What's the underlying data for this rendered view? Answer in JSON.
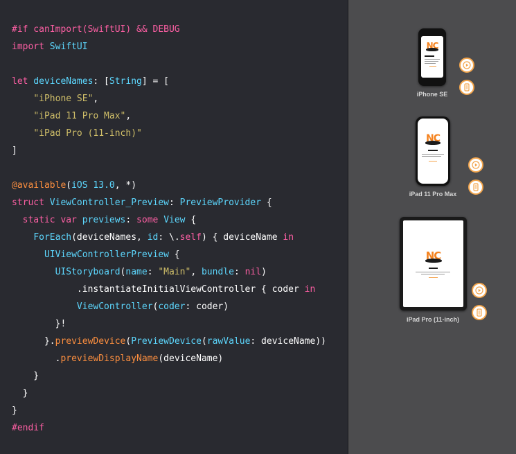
{
  "editor": {
    "lines": [
      [
        {
          "t": "#if canImport(SwiftUI) && DEBUG",
          "c": "keyword"
        }
      ],
      [
        {
          "t": "import",
          "c": "keyword"
        },
        {
          "t": " SwiftUI",
          "c": "decl"
        }
      ],
      [],
      [
        {
          "t": "let",
          "c": "keyword"
        },
        {
          "t": " deviceNames",
          "c": "decl"
        },
        {
          "t": ": [",
          "c": "plain"
        },
        {
          "t": "String",
          "c": "decl"
        },
        {
          "t": "] = [",
          "c": "plain"
        }
      ],
      [
        {
          "t": "    ",
          "c": "plain"
        },
        {
          "t": "\"iPhone SE\"",
          "c": "number"
        },
        {
          "t": ",",
          "c": "plain"
        }
      ],
      [
        {
          "t": "    ",
          "c": "plain"
        },
        {
          "t": "\"iPad 11 Pro Max\"",
          "c": "number"
        },
        {
          "t": ",",
          "c": "plain"
        }
      ],
      [
        {
          "t": "    ",
          "c": "plain"
        },
        {
          "t": "\"iPad Pro (11-inch)\"",
          "c": "number"
        }
      ],
      [
        {
          "t": "]",
          "c": "plain"
        }
      ],
      [],
      [
        {
          "t": "@available",
          "c": "orange"
        },
        {
          "t": "(",
          "c": "plain"
        },
        {
          "t": "iOS 13.0",
          "c": "decl"
        },
        {
          "t": ", *)",
          "c": "plain"
        }
      ],
      [
        {
          "t": "struct",
          "c": "keyword"
        },
        {
          "t": " ViewController_Preview",
          "c": "decl"
        },
        {
          "t": ": ",
          "c": "plain"
        },
        {
          "t": "PreviewProvider",
          "c": "decl"
        },
        {
          "t": " {",
          "c": "plain"
        }
      ],
      [
        {
          "t": "  ",
          "c": "plain"
        },
        {
          "t": "static",
          "c": "keyword"
        },
        {
          "t": " ",
          "c": "plain"
        },
        {
          "t": "var",
          "c": "keyword"
        },
        {
          "t": " previews",
          "c": "decl"
        },
        {
          "t": ": ",
          "c": "plain"
        },
        {
          "t": "some",
          "c": "keyword"
        },
        {
          "t": " ",
          "c": "plain"
        },
        {
          "t": "View",
          "c": "decl"
        },
        {
          "t": " {",
          "c": "plain"
        }
      ],
      [
        {
          "t": "    ",
          "c": "plain"
        },
        {
          "t": "ForEach",
          "c": "decl"
        },
        {
          "t": "(deviceNames, ",
          "c": "plain"
        },
        {
          "t": "id",
          "c": "decl"
        },
        {
          "t": ": \\.",
          "c": "plain"
        },
        {
          "t": "self",
          "c": "keyword"
        },
        {
          "t": ") { deviceName ",
          "c": "plain"
        },
        {
          "t": "in",
          "c": "keyword"
        }
      ],
      [
        {
          "t": "      ",
          "c": "plain"
        },
        {
          "t": "UIViewControllerPreview",
          "c": "decl"
        },
        {
          "t": " {",
          "c": "plain"
        }
      ],
      [
        {
          "t": "        ",
          "c": "plain"
        },
        {
          "t": "UIStoryboard",
          "c": "decl"
        },
        {
          "t": "(",
          "c": "plain"
        },
        {
          "t": "name",
          "c": "decl"
        },
        {
          "t": ": ",
          "c": "plain"
        },
        {
          "t": "\"Main\"",
          "c": "number"
        },
        {
          "t": ", ",
          "c": "plain"
        },
        {
          "t": "bundle",
          "c": "decl"
        },
        {
          "t": ": ",
          "c": "plain"
        },
        {
          "t": "nil",
          "c": "keyword"
        },
        {
          "t": ")",
          "c": "plain"
        }
      ],
      [
        {
          "t": "            .instantiateInitialViewController { coder ",
          "c": "plain"
        },
        {
          "t": "in",
          "c": "keyword"
        }
      ],
      [
        {
          "t": "            ",
          "c": "plain"
        },
        {
          "t": "ViewController",
          "c": "decl"
        },
        {
          "t": "(",
          "c": "plain"
        },
        {
          "t": "coder",
          "c": "decl"
        },
        {
          "t": ": coder)",
          "c": "plain"
        }
      ],
      [
        {
          "t": "        }!",
          "c": "plain"
        },
        {
          "t": "",
          "c": "plain"
        }
      ],
      [
        {
          "t": "      }.",
          "c": "plain"
        },
        {
          "t": "previewDevice",
          "c": "orange"
        },
        {
          "t": "(",
          "c": "plain"
        },
        {
          "t": "PreviewDevice",
          "c": "decl"
        },
        {
          "t": "(",
          "c": "plain"
        },
        {
          "t": "rawValue",
          "c": "decl"
        },
        {
          "t": ": deviceName))",
          "c": "plain"
        }
      ],
      [
        {
          "t": "        .",
          "c": "plain"
        },
        {
          "t": "previewDisplayName",
          "c": "orange"
        },
        {
          "t": "(deviceName)",
          "c": "plain"
        }
      ],
      [
        {
          "t": "    }",
          "c": "plain"
        }
      ],
      [
        {
          "t": "  }",
          "c": "plain"
        }
      ],
      [
        {
          "t": "}",
          "c": "plain"
        }
      ],
      [
        {
          "t": "#endif",
          "c": "keyword"
        }
      ]
    ]
  },
  "canvas": {
    "previews": [
      {
        "label": "iPhone SE",
        "logo": "NC",
        "icon": "mustache-logo-icon"
      },
      {
        "label": "iPad 11 Pro Max",
        "logo": "NC",
        "icon": "mustache-logo-icon"
      },
      {
        "label": "iPad Pro (11-inch)",
        "logo": "NC",
        "icon": "mustache-logo-icon"
      }
    ],
    "controls": {
      "live_preview_icon": "play-icon",
      "device_icon": "device-icon"
    },
    "accent": "#f3a54c"
  }
}
